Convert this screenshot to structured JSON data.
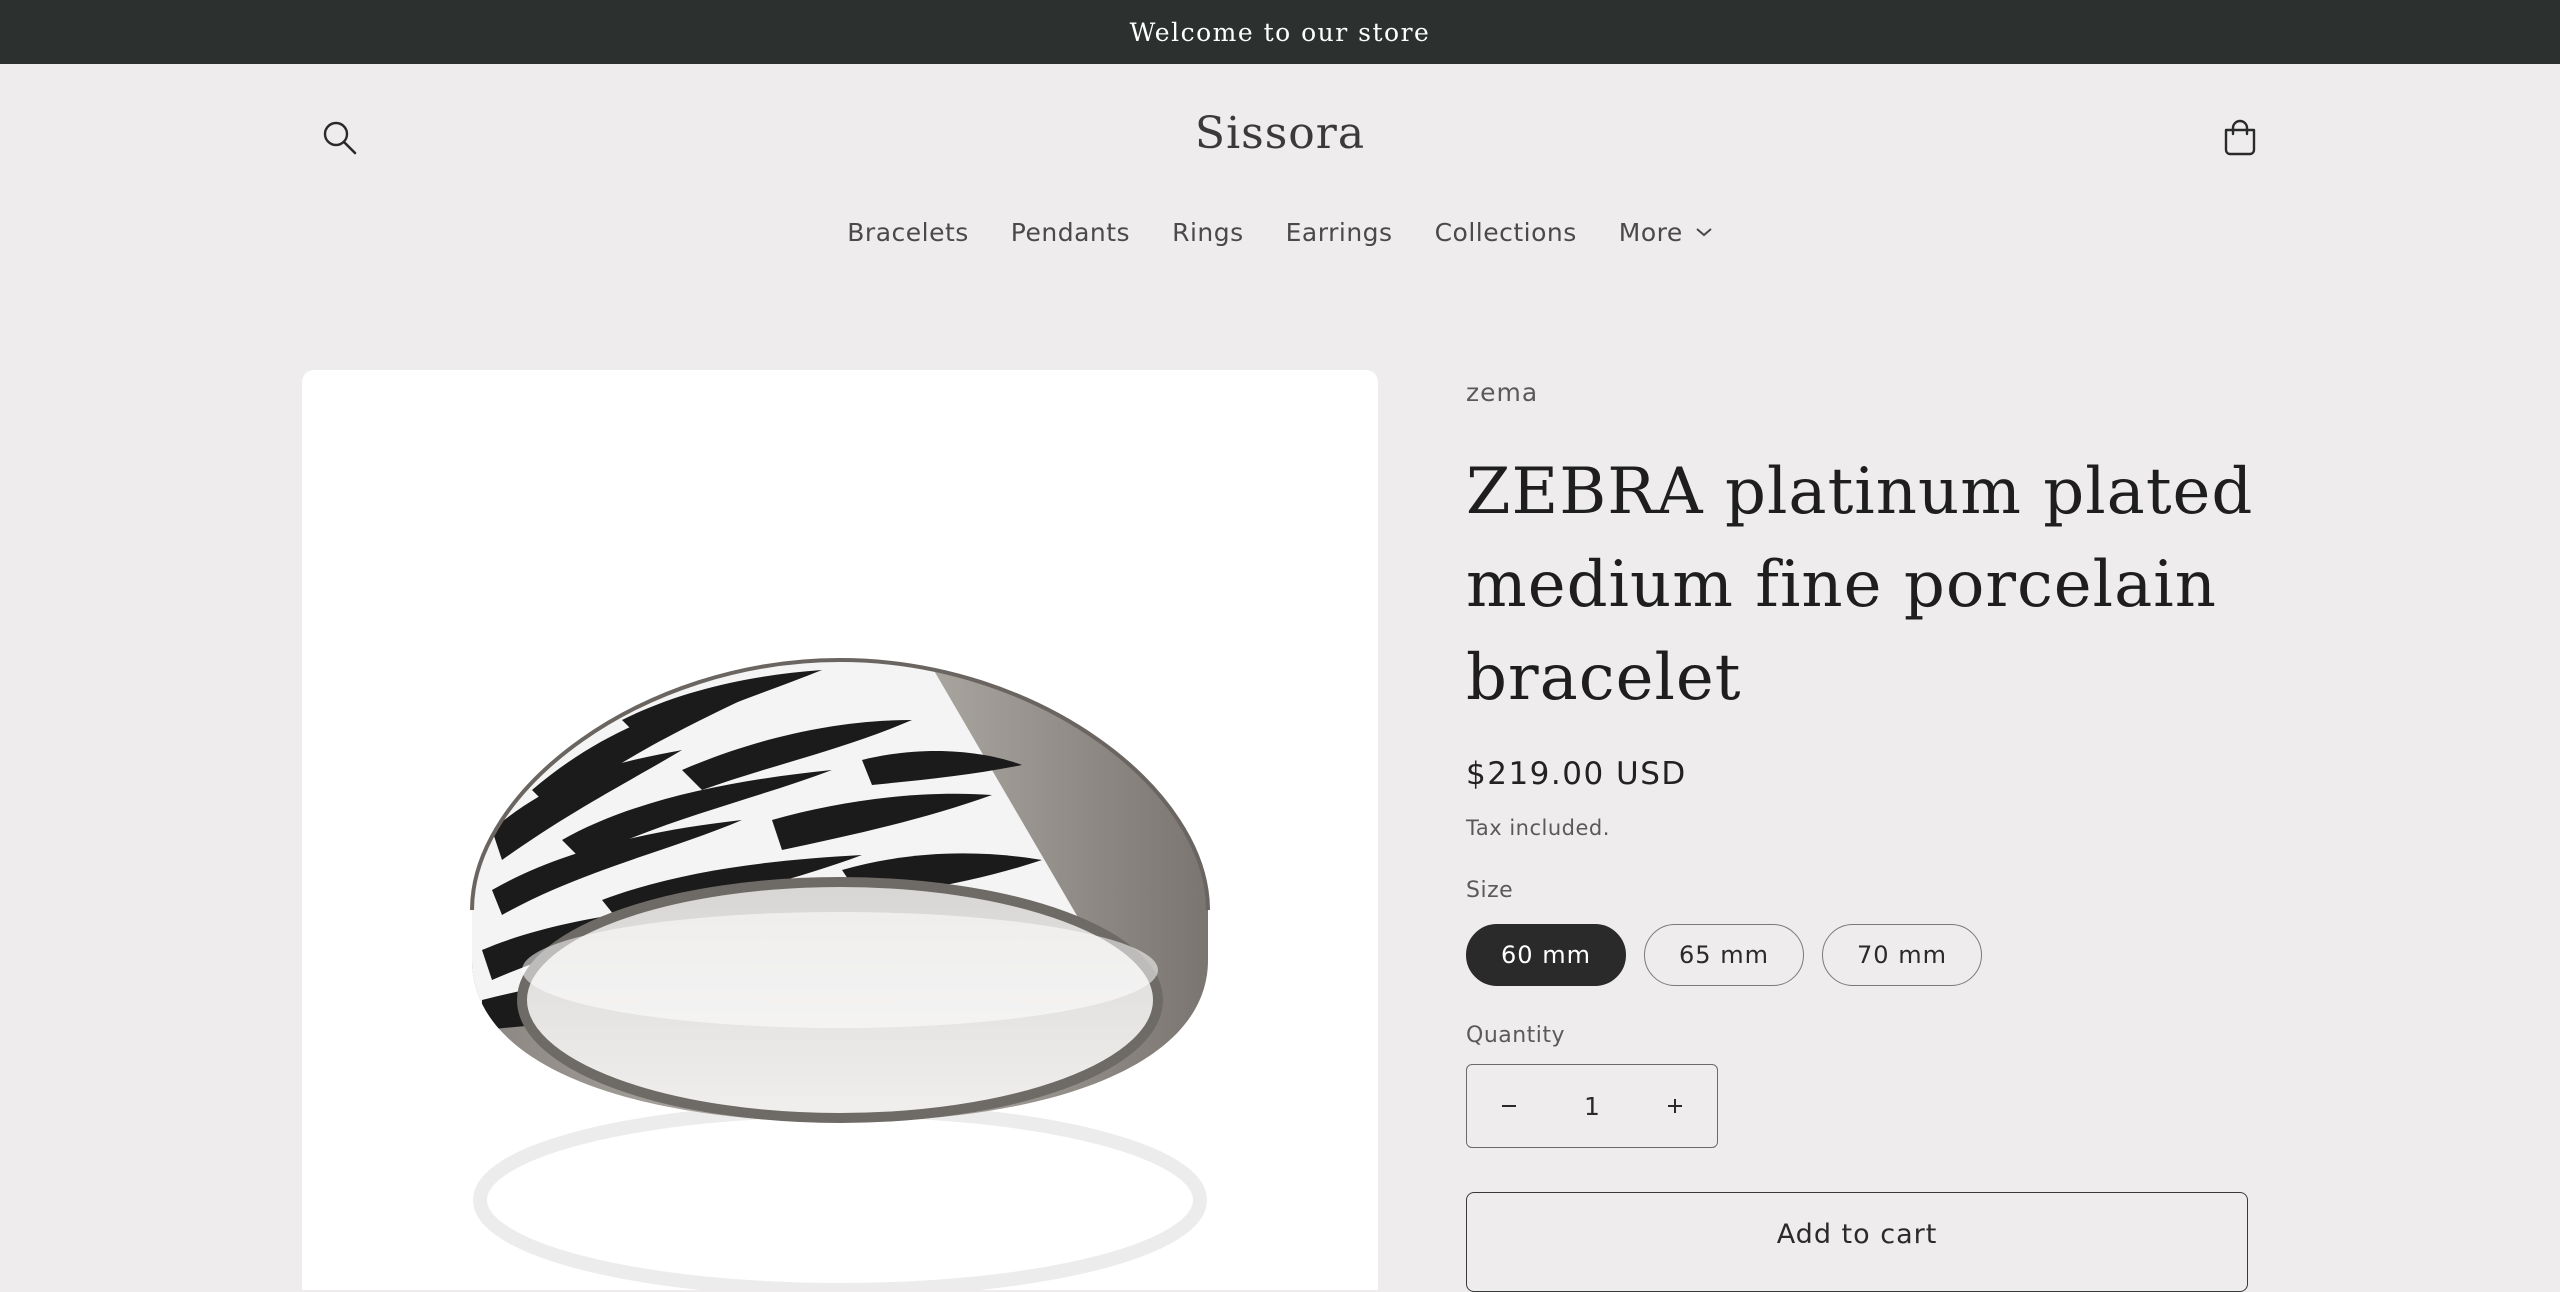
{
  "announcement": {
    "text": "Welcome to our store"
  },
  "header": {
    "brand": "Sissora",
    "search_icon": "search-icon",
    "cart_icon": "shopping-bag-icon"
  },
  "nav": {
    "items": [
      {
        "label": "Bracelets"
      },
      {
        "label": "Pendants"
      },
      {
        "label": "Rings"
      },
      {
        "label": "Earrings"
      },
      {
        "label": "Collections"
      },
      {
        "label": "More",
        "icon": "chevron-down-icon"
      }
    ]
  },
  "product": {
    "vendor": "zema",
    "title": "ZEBRA platinum plated medium fine porcelain bracelet",
    "price": "$219.00 USD",
    "tax_note": "Tax included.",
    "size_label": "Size",
    "sizes": [
      {
        "label": "60 mm",
        "selected": true
      },
      {
        "label": "65 mm",
        "selected": false
      },
      {
        "label": "70 mm",
        "selected": false
      }
    ],
    "quantity_label": "Quantity",
    "quantity": "1",
    "add_to_cart": "Add to cart"
  },
  "colors": {
    "announcement_bg": "#2c3130",
    "page_bg": "#eeeced",
    "selected_pill": "#2a2a2a"
  }
}
